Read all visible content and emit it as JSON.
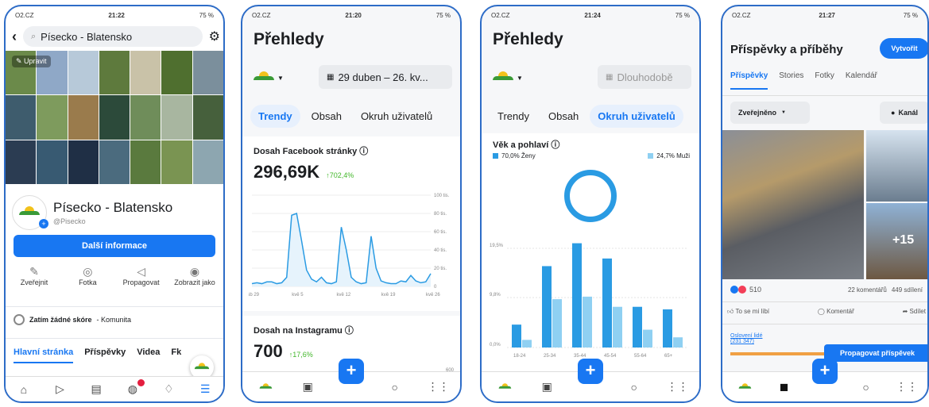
{
  "status": {
    "carrier": "O2.CZ",
    "battery": "75 %",
    "times": [
      "21:22",
      "21:20",
      "21:24",
      "21:27"
    ],
    "battery4": "75 %"
  },
  "p1": {
    "search": "Písecko - Blatensko",
    "edit": "Upravit",
    "name": "Písecko - Blatensko",
    "handle": "@Pisecko",
    "more_info": "Další informace",
    "actions": [
      "Zveřejnit",
      "Fotka",
      "Propagovat",
      "Zobrazit jako"
    ],
    "score": "Zatím žádné skóre",
    "score_suffix": " - Komunita",
    "tabs": [
      "Hlavní stránka",
      "Příspěvky",
      "Videa",
      "Fk"
    ]
  },
  "p2": {
    "title": "Přehledy",
    "date": "29 duben – 26. kv...",
    "tabs": [
      "Trendy",
      "Obsah",
      "Okruh uživatelů"
    ],
    "reach_title": "Dosah Facebook stránky",
    "reach_value": "296,69K",
    "reach_delta": "↑702,4%",
    "ig_title": "Dosah na Instagramu",
    "ig_value": "700",
    "ig_delta": "↑17,6%",
    "ig_tick": "600"
  },
  "p3": {
    "title": "Přehledy",
    "period": "Dlouhodobě",
    "tabs": [
      "Trendy",
      "Obsah",
      "Okruh uživatelů"
    ],
    "age_title": "Věk a pohlaví",
    "legend_f": "70,0% Ženy",
    "legend_m": "24,7% Muži"
  },
  "p4": {
    "title": "Příspěvky a příběhy",
    "create": "Vytvořit",
    "tabs": [
      "Příspěvky",
      "Stories",
      "Fotky",
      "Kalendář"
    ],
    "filter": "Zveřejněno",
    "channel": "Kanál",
    "plus": "+15",
    "reactions": "510",
    "comments": "22 komentářů",
    "shares": "449 sdílení",
    "like": "To se mi líbí",
    "comment": "Komentář",
    "share": "Sdílet",
    "reached_label": "Oslovení lidé",
    "reached_value": "(231 347)",
    "boost": "Propagovat příspěvek"
  },
  "chart_data": [
    {
      "type": "line",
      "title": "Dosah Facebook stránky",
      "x": [
        "úb 29",
        "kvě 5",
        "kvě 12",
        "kvě 19",
        "kvě 26"
      ],
      "yticks": [
        "100 tis.",
        "80 tis.",
        "60 tis.",
        "40 tis.",
        "20 tis.",
        "0"
      ],
      "series": [
        {
          "values": [
            3,
            4,
            3,
            5,
            5,
            3,
            4,
            10,
            78,
            80,
            50,
            18,
            8,
            5,
            10,
            4,
            3,
            5,
            65,
            40,
            10,
            5,
            3,
            4,
            55,
            20,
            6,
            4,
            3,
            3,
            6,
            5,
            12,
            6,
            4,
            5,
            14
          ]
        }
      ]
    },
    {
      "type": "bar",
      "title": "Věk a pohlaví",
      "categories": [
        "18-24",
        "25-34",
        "35-44",
        "45-54",
        "55-64",
        "65+"
      ],
      "yticks": [
        "19,5%",
        "9,8%",
        "0,0%"
      ],
      "series": [
        {
          "name": "Ženy",
          "values": [
            4.5,
            16.0,
            20.5,
            17.5,
            8.0,
            7.5
          ]
        },
        {
          "name": "Muži",
          "values": [
            1.5,
            9.5,
            10.0,
            8.0,
            3.5,
            2.0
          ]
        }
      ]
    }
  ]
}
